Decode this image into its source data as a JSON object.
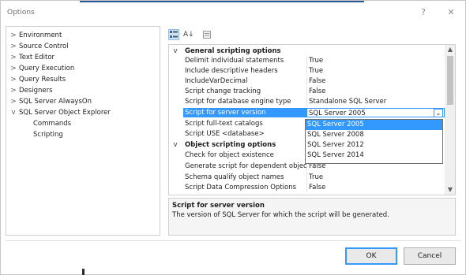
{
  "window": {
    "title": "Options",
    "help_glyph": "?",
    "close_glyph": "✕"
  },
  "tree": {
    "items": [
      {
        "label": "Environment",
        "arrow": ">"
      },
      {
        "label": "Source Control",
        "arrow": ">"
      },
      {
        "label": "Text Editor",
        "arrow": ">"
      },
      {
        "label": "Query Execution",
        "arrow": ">"
      },
      {
        "label": "Query Results",
        "arrow": ">"
      },
      {
        "label": "Designers",
        "arrow": ">"
      },
      {
        "label": "SQL Server AlwaysOn",
        "arrow": ">"
      },
      {
        "label": "SQL Server Object Explorer",
        "arrow": "v"
      }
    ],
    "children": [
      {
        "label": "Commands"
      },
      {
        "label": "Scripting"
      }
    ]
  },
  "toolbar": {
    "categorized_icon": "categorized-icon",
    "alphabetical_glyph": "A↓",
    "pages_icon": "property-pages-icon"
  },
  "grid": {
    "categories": [
      {
        "label": "General scripting options",
        "toggle": "v"
      },
      {
        "label": "Object scripting options",
        "toggle": "v"
      }
    ],
    "rows": [
      {
        "name": "Delimit individual statements",
        "value": "True"
      },
      {
        "name": "Include descriptive headers",
        "value": "True"
      },
      {
        "name": "IncludeVarDecimal",
        "value": "False"
      },
      {
        "name": "Script change tracking",
        "value": "False"
      },
      {
        "name": "Script for database engine type",
        "value": "Standalone SQL Server"
      },
      {
        "name": "Script for server version",
        "value": "SQL Server 2005"
      },
      {
        "name": "Script full-text catalogs",
        "value": ""
      },
      {
        "name": "Script USE <database>",
        "value": ""
      },
      {
        "name": "Check for object existence",
        "value": ""
      },
      {
        "name": "Generate script for dependent objects",
        "value": "False"
      },
      {
        "name": "Schema qualify object names",
        "value": "True"
      },
      {
        "name": "Script Data Compression Options",
        "value": "False"
      }
    ],
    "dropdown_glyph": "⌄",
    "scroll_up": "▲",
    "scroll_down": "▼"
  },
  "dropdown": {
    "options": [
      "SQL Server 2005",
      "SQL Server 2008",
      "SQL Server 2012",
      "SQL Server 2014"
    ],
    "highlighted": "SQL Server 2005"
  },
  "description": {
    "title": "Script for server version",
    "text": "The version of SQL Server for which the script will be generated."
  },
  "buttons": {
    "ok": "OK",
    "cancel": "Cancel"
  },
  "colors": {
    "selection": "#3399ff",
    "accent_strip": "#2b579a"
  }
}
